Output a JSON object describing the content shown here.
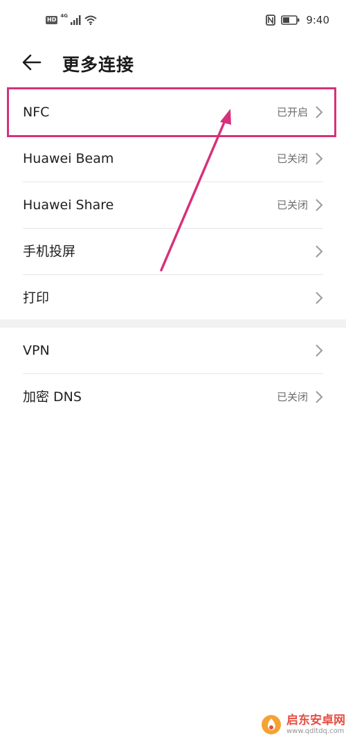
{
  "status_bar": {
    "left_icons": [
      "hd-icon",
      "4g-signal-icon",
      "wifi-icon"
    ],
    "hd_badge": "HD",
    "network": "4G",
    "right_icons": [
      "nfc-icon",
      "battery-icon"
    ],
    "time": "9:40"
  },
  "header": {
    "back_icon": "arrow-left-icon",
    "title": "更多连接"
  },
  "groups": [
    {
      "items": [
        {
          "label": "NFC",
          "status": "已开启"
        },
        {
          "label": "Huawei Beam",
          "status": "已关闭"
        },
        {
          "label": "Huawei Share",
          "status": "已关闭"
        },
        {
          "label": "手机投屏",
          "status": ""
        },
        {
          "label": "打印",
          "status": ""
        }
      ]
    },
    {
      "items": [
        {
          "label": "VPN",
          "status": ""
        },
        {
          "label": "加密 DNS",
          "status": "已关闭"
        }
      ]
    }
  ],
  "annotation": {
    "highlight_color": "#d6317a",
    "arrow_color": "#d6317a"
  },
  "watermark": {
    "name": "启东安卓网",
    "url": "www.qdltdq.com"
  }
}
